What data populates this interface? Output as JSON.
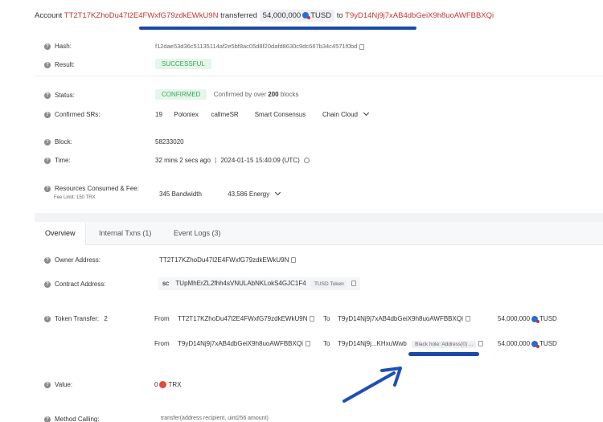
{
  "header": {
    "account_label": "Account",
    "account": "TT2T17KZhoDu47l2E4FWxfG79zdkEWkU9N",
    "transferred_label": "transferred",
    "amount": "54,000,000",
    "token": "TUSD",
    "to_label": "to",
    "to_address": "T9yD14Nj9j7xAB4dbGeiX9h8uoAWFBBXQi"
  },
  "details": {
    "hash_label": "Hash:",
    "hash": "f12dae53d36c51135114af2e5bf8ac05d8f20dafd8630c9dc667b34c4571f0bd",
    "result_label": "Result:",
    "result": "SUCCESSFUL",
    "status_label": "Status:",
    "status": "CONFIRMED",
    "confirmed_by_prefix": "Confirmed by over",
    "confirmed_by_count": "200",
    "confirmed_by_suffix": "blocks",
    "srs_label": "Confirmed SRs:",
    "srs": [
      "19",
      "Poloniex",
      "callmeSR",
      "Smart Consensus",
      "Chain Cloud"
    ],
    "block_label": "Block:",
    "block": "58233020",
    "time_label": "Time:",
    "time_ago": "32 mins 2 secs ago",
    "time_sep": "|",
    "time_utc": "2024-01-15 15:40:09 (UTC)",
    "resources_label": "Resources Consumed & Fee:",
    "fee_limit": "Fee Limit: 150 TRX",
    "bandwidth_value": "345",
    "bandwidth_label": "Bandwidth",
    "energy_value": "43,586",
    "energy_label": "Energy"
  },
  "tabs": [
    {
      "label": "Overview"
    },
    {
      "label": "Internal Txns (1)"
    },
    {
      "label": "Event Logs (3)"
    }
  ],
  "overview": {
    "owner_label": "Owner Address:",
    "owner": "TT2T17KZhoDu47l2E4FWxfG79zdkEWkU9N",
    "contract_label": "Contract Address:",
    "contract_tag": "SC",
    "contract": "TUpMhErZL2fhh4sVNULAbNKLokS4GJC1F4",
    "contract_token_tag": "TUSD Token",
    "token_transfer_label": "Token Transfer:",
    "token_transfer_count": "2",
    "transfers": [
      {
        "from_label": "From",
        "from": "TT2T17KZhoDu47l2E4FWxfG79zdkEWkU9N",
        "to_label": "To",
        "to": "T9yD14Nj9j7xAB4dbGeiX9h8uoAWFBBXQi",
        "to_tag": "",
        "amount": "54,000,000",
        "token": "TUSD"
      },
      {
        "from_label": "From",
        "from": "T9yD14Nj9j7xAB4dbGeiX9h8uoAWFBBXQi",
        "to_label": "To",
        "to": "T9yD14Nj9j...KHxuWwb",
        "to_tag": "Black hole: Address(0) ...",
        "amount": "54,000,000",
        "token": "TUSD"
      }
    ],
    "value_label": "Value:",
    "value": "0",
    "value_token": "TRX",
    "method_label": "Method Calling:",
    "method": "transfer(address recipient, uint256 amount)"
  },
  "colors": {
    "link_red": "#c23631",
    "underline_blue": "#1a4aa8",
    "arrow_blue": "#1f4fb5",
    "success_green": "#35a760"
  },
  "icons": [
    "question-icon",
    "copy-icon",
    "tusd-coin-icon",
    "trx-coin-icon",
    "chevron-down-icon",
    "clock-icon"
  ]
}
